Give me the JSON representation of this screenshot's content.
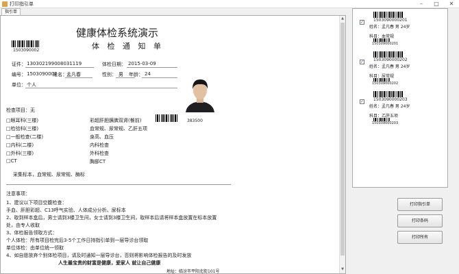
{
  "window": {
    "title": "打印指引单"
  },
  "tabs": [
    {
      "label": "指引单"
    }
  ],
  "doc": {
    "title": "健康体检系统演示",
    "subtitle": "体 检 通 知 单",
    "top_barcode_number": "1503090002",
    "id_label": "证件：",
    "id_value": "130302199008031119",
    "date_label": "体检日期：",
    "date_value": "2015-03-09",
    "no_label": "编号：",
    "no_value": "1503090002",
    "name_label": "姓名：",
    "name_value": "孟凡春",
    "sex_label": "性别：",
    "sex_value": "男",
    "age_label": "年龄：",
    "age_value": "24",
    "unit_label": "单位：",
    "unit_value": "个人",
    "items_label": "检查项目：无",
    "left_items": [
      "□眼耳科(三楼)",
      "□检验科(三楼)",
      "□一般检查(二楼)",
      "□内科(二楼)",
      "□外科(三楼)",
      "□CT"
    ],
    "right_items": [
      "彩超肝胆胰脾双肾(餐前)",
      "血常规、尿常规、乙肝五项",
      "身高、血压",
      "内科检查",
      "外科检查",
      "胸部CT"
    ],
    "barcode2_number": "383500",
    "sample_line": "采集标本，血常规、尿常规、酶标",
    "notes_title": "注意事项：",
    "notes": [
      "1、建议以下项目空腹检查：",
      "    手血、肝胆彩超、C13呼气实验、人体成分分析、尿标本",
      "2、取到样本盒后，男士请到3楼卫生间，女士请到3楼卫生间，取样本后请将样本盒放置在标本放置",
      "    处，由专人收取",
      "3、体检报告领取方式：",
      "    个人体检：所有项目检完后3-5个工作日持指引单到一层导诊台领取",
      "    单位体检：由单位统一领取",
      "4、如自愿放弃个别体检项目，请及时通知一层导诊台，否则将影响体检报告的及时发放"
    ],
    "slogan": "人生最宝贵的财富是健康，爱家人   就让自己健康",
    "address": "地址：临汾市平阳北街101号"
  },
  "cards": [
    {
      "code": "1503090000201",
      "name": "姓名：孟凡春 男 24岁",
      "dept": "科目：血常规",
      "small": "150309000201"
    },
    {
      "code": "1503090000202",
      "name": "姓名：孟凡春 男 24岁",
      "dept": "科目：尿常规",
      "small": "150309000202"
    },
    {
      "code": "1503090000203",
      "name": "姓名：孟凡春 男 24岁",
      "dept": "科目：乙肝五项",
      "small": "150309000203"
    }
  ],
  "buttons": {
    "print_guide": "打印指引单",
    "print_barcode": "打印条码",
    "print_all": "打印所有"
  }
}
